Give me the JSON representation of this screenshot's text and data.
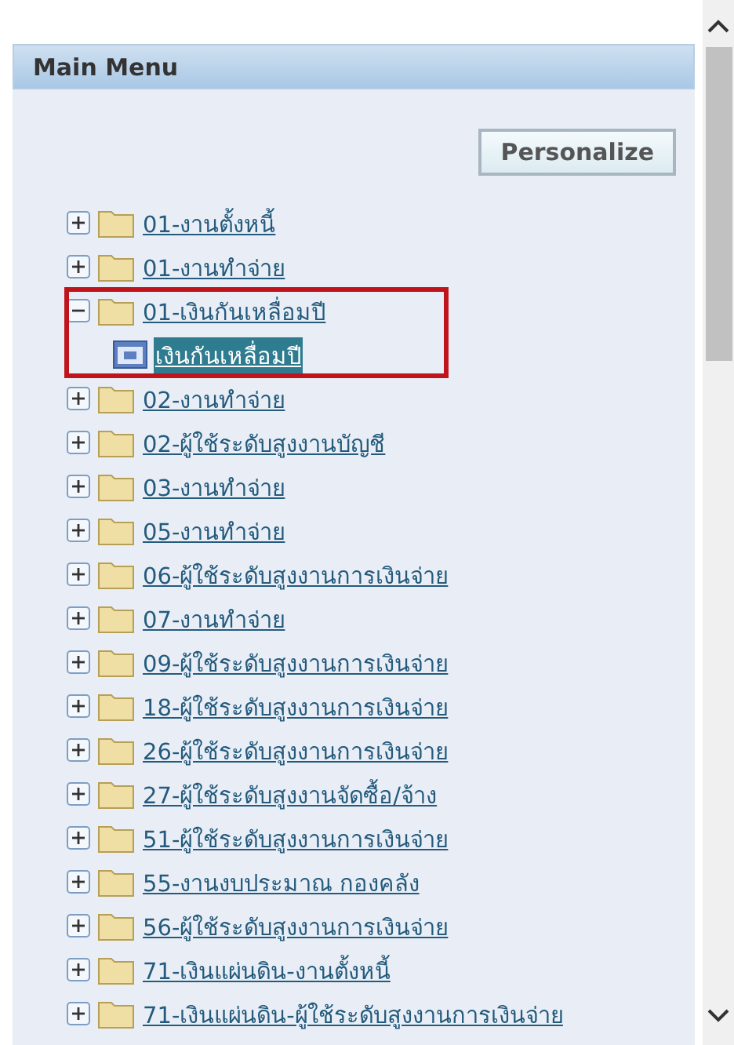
{
  "panel": {
    "title": "Main Menu"
  },
  "personalize_button": "Personalize",
  "tree": [
    {
      "label": "01-งานตั้งหนี้",
      "expanded": false,
      "highlighted": false
    },
    {
      "label": "01-งานทำจ่าย",
      "expanded": false,
      "highlighted": false
    },
    {
      "label": "01-เงินกันเหลื่อมปี",
      "expanded": true,
      "highlighted": true,
      "children": [
        {
          "label": "เงินกันเหลื่อมปี",
          "kind": "page",
          "selected": true
        }
      ]
    },
    {
      "label": "02-งานทำจ่าย",
      "expanded": false,
      "highlighted": false
    },
    {
      "label": "02-ผู้ใช้ระดับสูงงานบัญชี",
      "expanded": false,
      "highlighted": false
    },
    {
      "label": "03-งานทำจ่าย",
      "expanded": false,
      "highlighted": false
    },
    {
      "label": "05-งานทำจ่าย",
      "expanded": false,
      "highlighted": false
    },
    {
      "label": "06-ผู้ใช้ระดับสูงงานการเงินจ่าย",
      "expanded": false,
      "highlighted": false
    },
    {
      "label": "07-งานทำจ่าย",
      "expanded": false,
      "highlighted": false
    },
    {
      "label": "09-ผู้ใช้ระดับสูงงานการเงินจ่าย",
      "expanded": false,
      "highlighted": false
    },
    {
      "label": "18-ผู้ใช้ระดับสูงงานการเงินจ่าย",
      "expanded": false,
      "highlighted": false
    },
    {
      "label": "26-ผู้ใช้ระดับสูงงานการเงินจ่าย",
      "expanded": false,
      "highlighted": false
    },
    {
      "label": "27-ผู้ใช้ระดับสูงงานจัดซื้อ/จ้าง",
      "expanded": false,
      "highlighted": false
    },
    {
      "label": "51-ผู้ใช้ระดับสูงงานการเงินจ่าย",
      "expanded": false,
      "highlighted": false
    },
    {
      "label": "55-งานงบประมาณ กองคลัง",
      "expanded": false,
      "highlighted": false
    },
    {
      "label": "56-ผู้ใช้ระดับสูงงานการเงินจ่าย",
      "expanded": false,
      "highlighted": false
    },
    {
      "label": "71-เงินแผ่นดิน-งานตั้งหนี้",
      "expanded": false,
      "highlighted": false
    },
    {
      "label": "71-เงินแผ่นดิน-ผู้ใช้ระดับสูงงานการเงินจ่าย",
      "expanded": false,
      "highlighted": false
    }
  ]
}
